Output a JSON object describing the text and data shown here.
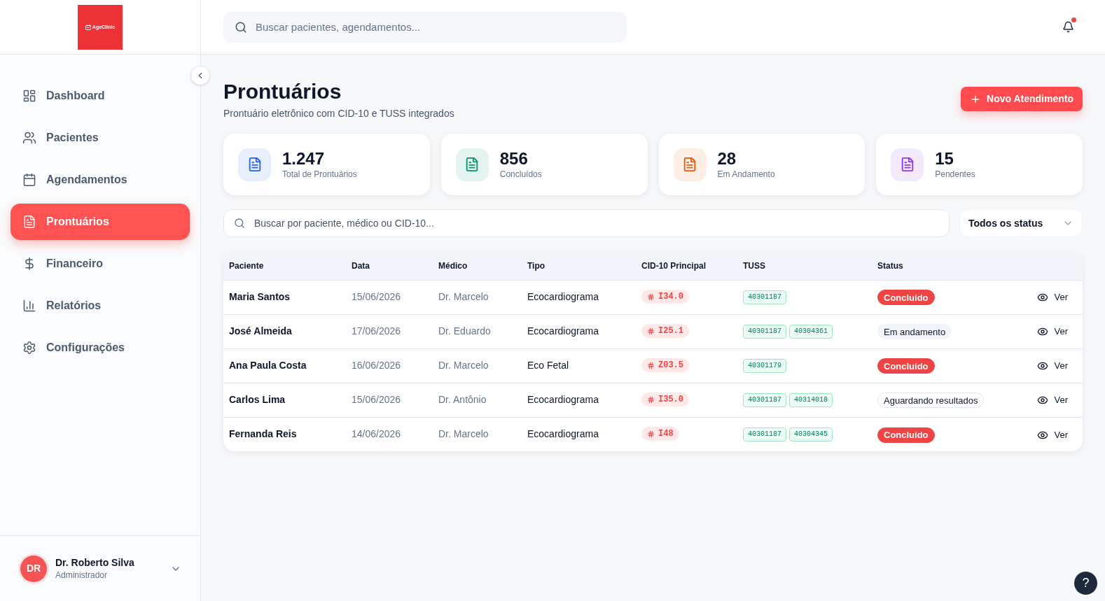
{
  "sidebar": {
    "logo": {
      "text": "AgeClinic"
    },
    "items": [
      {
        "label": "Dashboard",
        "selected": false
      },
      {
        "label": "Pacientes",
        "selected": false
      },
      {
        "label": "Agendamentos",
        "selected": false
      },
      {
        "label": "Prontuários",
        "selected": true
      },
      {
        "label": "Financeiro",
        "selected": false
      },
      {
        "label": "Relatórios",
        "selected": false
      },
      {
        "label": "Configurações",
        "selected": false
      }
    ],
    "user": {
      "initials": "DR",
      "name": "Dr. Roberto Silva",
      "role": "Administrador"
    }
  },
  "header": {
    "search": {
      "placeholder": "Buscar pacientes, agendamentos..."
    },
    "notifications": {
      "unread": true
    }
  },
  "page": {
    "title": "Prontuários",
    "subtitle": "Prontuário eletrônico com CID-10 e TUSS integrados",
    "primary_button": "Novo Atendimento"
  },
  "stats": [
    {
      "value": "1.247",
      "label": "Total de Prontuários",
      "color": "#2563eb"
    },
    {
      "value": "856",
      "label": "Concluídos",
      "color": "#059669"
    },
    {
      "value": "28",
      "label": "Em Andamento",
      "color": "#ea580c"
    },
    {
      "value": "15",
      "label": "Pendentes",
      "color": "#9333ea"
    }
  ],
  "filters": {
    "search": {
      "placeholder": "Buscar por paciente, médico ou CID-10..."
    },
    "status_select": {
      "value": "Todos os status"
    }
  },
  "table": {
    "columns": [
      "Paciente",
      "Data",
      "Médico",
      "Tipo",
      "CID-10 Principal",
      "TUSS",
      "Status"
    ],
    "rows": [
      {
        "patient": "Maria Santos",
        "date": "15/06/2026",
        "doctor": "Dr. Marcelo",
        "type": "Ecocardiograma",
        "cid": "I34.0",
        "tuss": [
          "40301187"
        ],
        "status": {
          "label": "Concluído",
          "kind": "completed"
        },
        "action": "Ver"
      },
      {
        "patient": "José Almeida",
        "date": "17/06/2026",
        "doctor": "Dr. Eduardo",
        "type": "Ecocardiograma",
        "cid": "I25.1",
        "tuss": [
          "40301187",
          "40304361"
        ],
        "status": {
          "label": "Em andamento",
          "kind": "in_progress"
        },
        "action": "Ver"
      },
      {
        "patient": "Ana Paula Costa",
        "date": "16/06/2026",
        "doctor": "Dr. Marcelo",
        "type": "Eco Fetal",
        "cid": "Z03.5",
        "tuss": [
          "40301179"
        ],
        "status": {
          "label": "Concluído",
          "kind": "completed"
        },
        "action": "Ver"
      },
      {
        "patient": "Carlos Lima",
        "date": "15/06/2026",
        "doctor": "Dr. Antônio",
        "type": "Ecocardiograma",
        "cid": "I35.0",
        "tuss": [
          "40301187",
          "40314018"
        ],
        "status": {
          "label": "Aguardando resultados",
          "kind": "awaiting"
        },
        "action": "Ver"
      },
      {
        "patient": "Fernanda Reis",
        "date": "14/06/2026",
        "doctor": "Dr. Marcelo",
        "type": "Ecocardiograma",
        "cid": "I48",
        "tuss": [
          "40301187",
          "40304345"
        ],
        "status": {
          "label": "Concluído",
          "kind": "completed"
        },
        "action": "Ver"
      }
    ]
  },
  "help_button": "?"
}
